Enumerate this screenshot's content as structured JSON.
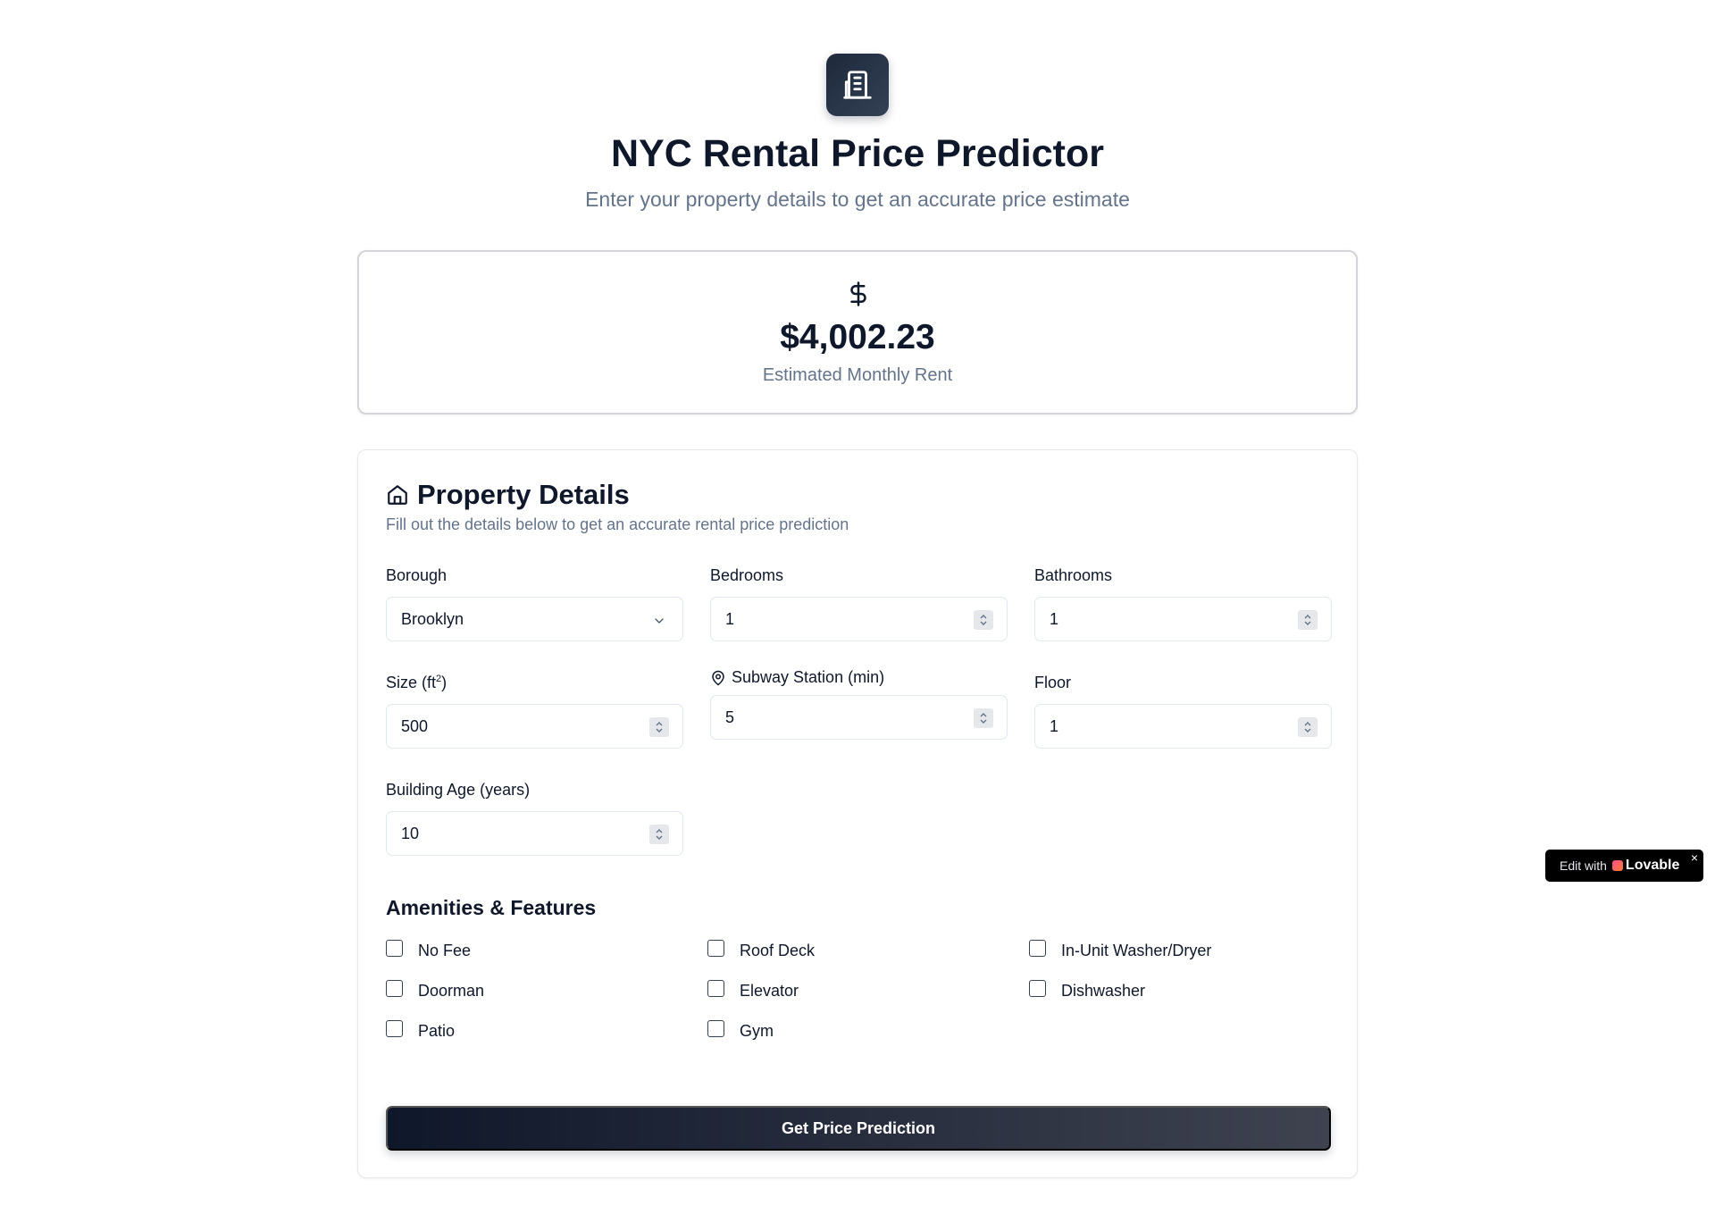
{
  "header": {
    "logo_icon": "building-icon",
    "title": "NYC Rental Price Predictor",
    "subtitle": "Enter your property details to get an accurate price estimate"
  },
  "result": {
    "icon": "dollar-icon",
    "price": "$4,002.23",
    "label": "Estimated Monthly Rent"
  },
  "form": {
    "icon": "home-icon",
    "title": "Property Details",
    "description": "Fill out the details below to get an accurate rental price prediction",
    "borough": {
      "label": "Borough",
      "value": "Brooklyn"
    },
    "bedrooms": {
      "label": "Bedrooms",
      "value": "1"
    },
    "bathrooms": {
      "label": "Bathrooms",
      "value": "1"
    },
    "size": {
      "label": "Size (ft",
      "label_sup": "2",
      "label_end": ")",
      "value": "500"
    },
    "subway": {
      "label": "Subway Station (min)",
      "value": "5"
    },
    "floor": {
      "label": "Floor",
      "value": "1"
    },
    "building_age": {
      "label": "Building Age (years)",
      "value": "10"
    },
    "amenities_title": "Amenities & Features",
    "amenities": [
      {
        "label": "No Fee",
        "checked": false
      },
      {
        "label": "Roof Deck",
        "checked": false
      },
      {
        "label": "In-Unit Washer/Dryer",
        "checked": false
      },
      {
        "label": "Doorman",
        "checked": false
      },
      {
        "label": "Elevator",
        "checked": false
      },
      {
        "label": "Dishwasher",
        "checked": false
      },
      {
        "label": "Patio",
        "checked": false
      },
      {
        "label": "Gym",
        "checked": false
      }
    ],
    "submit_label": "Get Price Prediction"
  },
  "badge": {
    "prefix": "Edit with",
    "brand": "Lovable",
    "close": "×"
  }
}
